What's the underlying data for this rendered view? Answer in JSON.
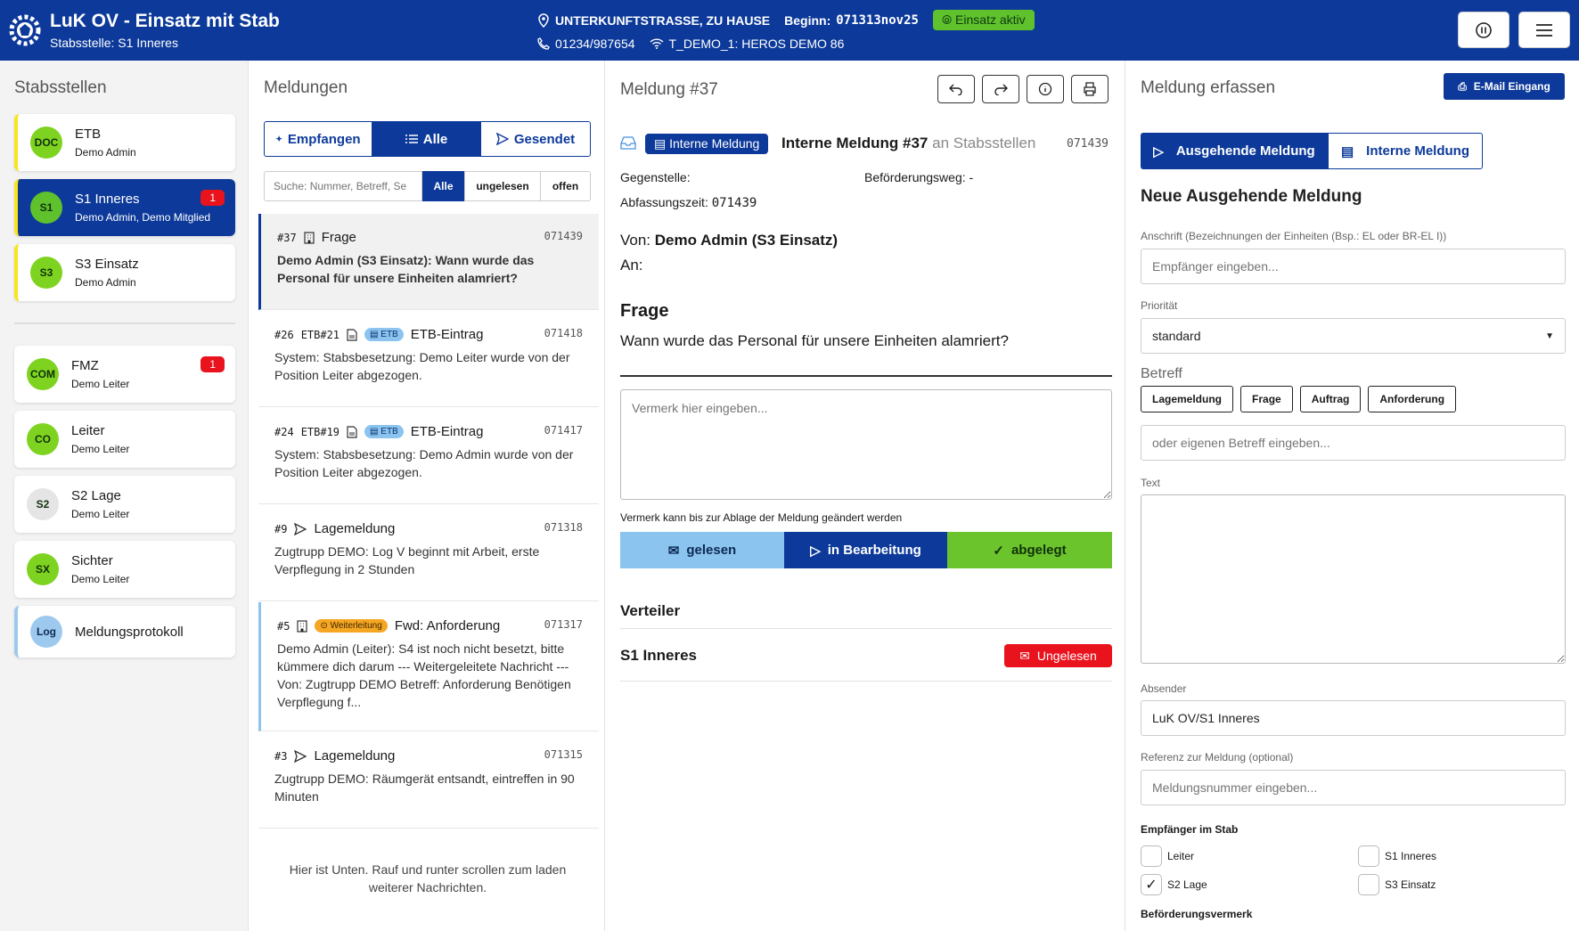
{
  "header": {
    "title": "LuK OV - Einsatz mit Stab",
    "subtitle": "Stabsstelle: S1 Inneres",
    "location": "UNTERKUNFTSTRASSE, ZU HAUSE",
    "begin_label": "Beginn:",
    "begin_value": "071313nov25",
    "status": "Einsatz aktiv",
    "phone": "01234/987654",
    "radio": "T_DEMO_1: HEROS DEMO 86"
  },
  "left": {
    "title": "Stabsstellen",
    "items": [
      {
        "abbr": "DOC",
        "name": "ETB",
        "sub": "Demo Admin",
        "color": "#7ed321"
      },
      {
        "abbr": "S1",
        "name": "S1 Inneres",
        "sub": "Demo Admin, Demo Mitglied",
        "count": "1",
        "color": "#5fc22d"
      },
      {
        "abbr": "S3",
        "name": "S3 Einsatz",
        "sub": "Demo Admin",
        "color": "#7ed321"
      },
      {
        "abbr": "COM",
        "name": "FMZ",
        "sub": "Demo Leiter",
        "count": "1",
        "color": "#7ed321"
      },
      {
        "abbr": "CO",
        "name": "Leiter",
        "sub": "Demo Leiter",
        "color": "#7ed321"
      },
      {
        "abbr": "S2",
        "name": "S2 Lage",
        "sub": "Demo Leiter",
        "color": "#e5e5e5"
      },
      {
        "abbr": "SX",
        "name": "Sichter",
        "sub": "Demo Leiter",
        "color": "#7ed321"
      },
      {
        "abbr": "Log",
        "name": "Meldungsprotokoll",
        "color": "#9ec9ef"
      }
    ]
  },
  "list": {
    "title": "Meldungen",
    "tabs": [
      "Empfangen",
      "Alle",
      "Gesendet"
    ],
    "search_placeholder": "Suche: Nummer, Betreff, Se",
    "filters": [
      "Alle",
      "ungelesen",
      "offen"
    ],
    "messages": [
      {
        "id": "#37",
        "subject": "Frage",
        "time": "071439",
        "text": "Demo Admin (S3 Einsatz): Wann wurde das Personal für unsere Einheiten alamriert?"
      },
      {
        "id": "#26",
        "etb": "ETB#21",
        "tag": "ETB",
        "subject": "ETB-Eintrag",
        "time": "071418",
        "text": "System: Stabsbesetzung: Demo Leiter wurde von der Position Leiter abgezogen."
      },
      {
        "id": "#24",
        "etb": "ETB#19",
        "tag": "ETB",
        "subject": "ETB-Eintrag",
        "time": "071417",
        "text": "System: Stabsbesetzung: Demo Admin wurde von der Position Leiter abgezogen."
      },
      {
        "id": "#9",
        "subject": "Lagemeldung",
        "time": "071318",
        "text": "Zugtrupp DEMO: Log V beginnt mit Arbeit, erste Verpflegung in 2 Stunden"
      },
      {
        "id": "#5",
        "tag": "Weiterleitung",
        "subject": "Fwd: Anforderung",
        "time": "071317",
        "text": "Demo Admin (Leiter): S4 ist noch nicht besetzt, bitte kümmere dich darum --- Weitergeleitete Nachricht --- Von: Zugtrupp DEMO Betreff: Anforderung Benötigen Verpflegung f..."
      },
      {
        "id": "#3",
        "subject": "Lagemeldung",
        "time": "071315",
        "text": "Zugtrupp DEMO: Räumgerät entsandt, eintreffen in 90 Minuten"
      }
    ],
    "footer": "Hier ist Unten. Rauf und runter scrollen zum laden weiterer Nachrichten."
  },
  "detail": {
    "title": "Meldung #37",
    "badge": "Interne Meldung",
    "heading": "Interne Meldung #37",
    "heading_suffix": "an Stabsstellen",
    "time": "071439",
    "gegenstelle": "Gegenstelle:",
    "beforderung": "Beförderungsweg: -",
    "abfassung_label": "Abfassungszeit:",
    "abfassung_value": "071439",
    "von_label": "Von:",
    "von_value": "Demo Admin (S3 Einsatz)",
    "an_label": "An:",
    "subject": "Frage",
    "body": "Wann wurde das Personal für unsere Einheiten alamriert?",
    "note_placeholder": "Vermerk hier eingeben...",
    "note_hint": "Vermerk kann bis zur Ablage der Meldung geändert werden",
    "status_buttons": [
      "gelesen",
      "in Bearbeitung",
      "abgelegt"
    ],
    "verteiler_title": "Verteiler",
    "verteiler_name": "S1 Inneres",
    "verteiler_status": "Ungelesen"
  },
  "form": {
    "title": "Meldung erfassen",
    "email_button": "E-Mail Eingang",
    "tabs": [
      "Ausgehende Meldung",
      "Interne Meldung"
    ],
    "heading": "Neue Ausgehende Meldung",
    "anschrift_label": "Anschrift (Bezeichnungen der Einheiten (Bsp.: EL oder BR-EL I))",
    "anschrift_placeholder": "Empfänger eingeben...",
    "prio_label": "Priorität",
    "prio_value": "standard",
    "betreff_label": "Betreff",
    "betreff_chips": [
      "Lagemeldung",
      "Frage",
      "Auftrag",
      "Anforderung"
    ],
    "betreff_placeholder": "oder eigenen Betreff eingeben...",
    "text_label": "Text",
    "absender_label": "Absender",
    "absender_value": "LuK OV/S1 Inneres",
    "referenz_label": "Referenz zur Meldung (optional)",
    "referenz_placeholder": "Meldungsnummer eingeben...",
    "empf_label": "Empfänger im Stab",
    "recipients": [
      {
        "name": "Leiter",
        "checked": false
      },
      {
        "name": "S1 Inneres",
        "checked": false
      },
      {
        "name": "S2 Lage",
        "checked": true
      },
      {
        "name": "S3 Einsatz",
        "checked": false
      }
    ],
    "bef_label": "Beförderungsvermerk"
  }
}
